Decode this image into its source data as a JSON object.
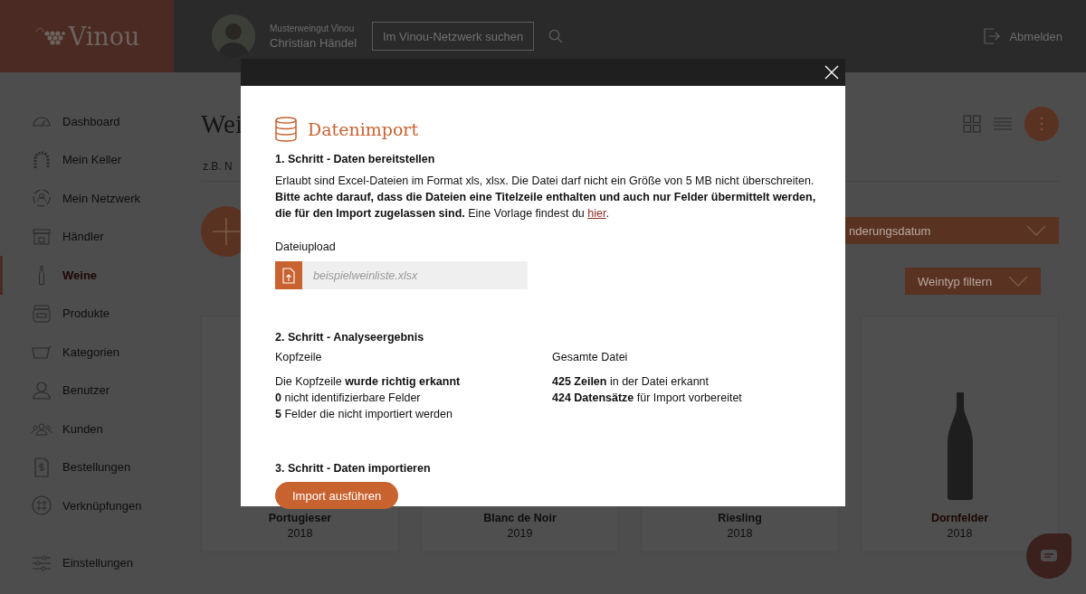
{
  "header": {
    "brand": "Vinou",
    "account": "Musterweingut Vinou",
    "user": "Christian Händel",
    "search": {
      "placeholder": "Im Vinou-Netzwerk suchen"
    },
    "logout": "Abmelden"
  },
  "sidebar": {
    "items": [
      {
        "label": "Dashboard",
        "selected": false
      },
      {
        "label": "Mein Keller",
        "selected": false
      },
      {
        "label": "Mein Netzwerk",
        "selected": false
      },
      {
        "label": "Händler",
        "selected": false
      },
      {
        "label": "Weine",
        "selected": true
      },
      {
        "label": "Produkte",
        "selected": false
      },
      {
        "label": "Kategorien",
        "selected": false
      },
      {
        "label": "Benutzer",
        "selected": false
      },
      {
        "label": "Kunden",
        "selected": false
      },
      {
        "label": "Bestellungen",
        "selected": false
      },
      {
        "label": "Verknüpfungen",
        "selected": false
      }
    ],
    "footer": {
      "label": "Einstellungen",
      "selected": false
    }
  },
  "main": {
    "title": "Wei",
    "search": {
      "placeholder": "z.B. N"
    },
    "sort": {
      "value": "nderungsdatum"
    },
    "filter": {
      "value": "Weintyp filtern"
    },
    "cards": [
      {
        "name": "Portugieser",
        "year": "2018",
        "kind": "plain"
      },
      {
        "name": "Blanc de Noir",
        "year": "2019",
        "kind": "plain"
      },
      {
        "name": "Riesling",
        "year": "2018",
        "kind": "plain"
      },
      {
        "name": "Dornfelder",
        "year": "2018",
        "kind": "bottle"
      }
    ]
  },
  "modal": {
    "title": "Datenimport",
    "step1": {
      "heading": "1. Schritt - Daten bereitstellen",
      "lines": [
        "Erlaubt sind Excel-Dateien im Format xls, xlsx. Die Datei darf nicht ein Größe von 5 MB nicht überschreiten.",
        "**Bitte achte darauf, dass die Dateien eine Titelzeile enthalten und auch nur Felder übermittelt werden, die für den Import zugelassen sind.** Eine Vorlage findest du"
      ],
      "link": "hier",
      "after": ".",
      "upload_label": "Dateiupload",
      "upload": {
        "placeholder": "beispielweinliste.xlsx"
      }
    },
    "step2": {
      "heading": "2. Schritt - Analyseergebnis",
      "columns": [
        {
          "title": "Kopfzeile",
          "lines": [
            "Die Kopfzeile **wurde richtig erkannt**",
            "**0** nicht identifizierbare Felder",
            "**5** Felder die nicht importiert werden"
          ]
        },
        {
          "title": "Gesamte Datei",
          "lines": [
            "**425 Zeilen** in der Datei erkannt",
            "**424 Datensätze** für Import vorbereitet"
          ]
        }
      ]
    },
    "step3": {
      "heading": "3. Schritt - Daten importieren",
      "button": "Import ausführen"
    }
  }
}
